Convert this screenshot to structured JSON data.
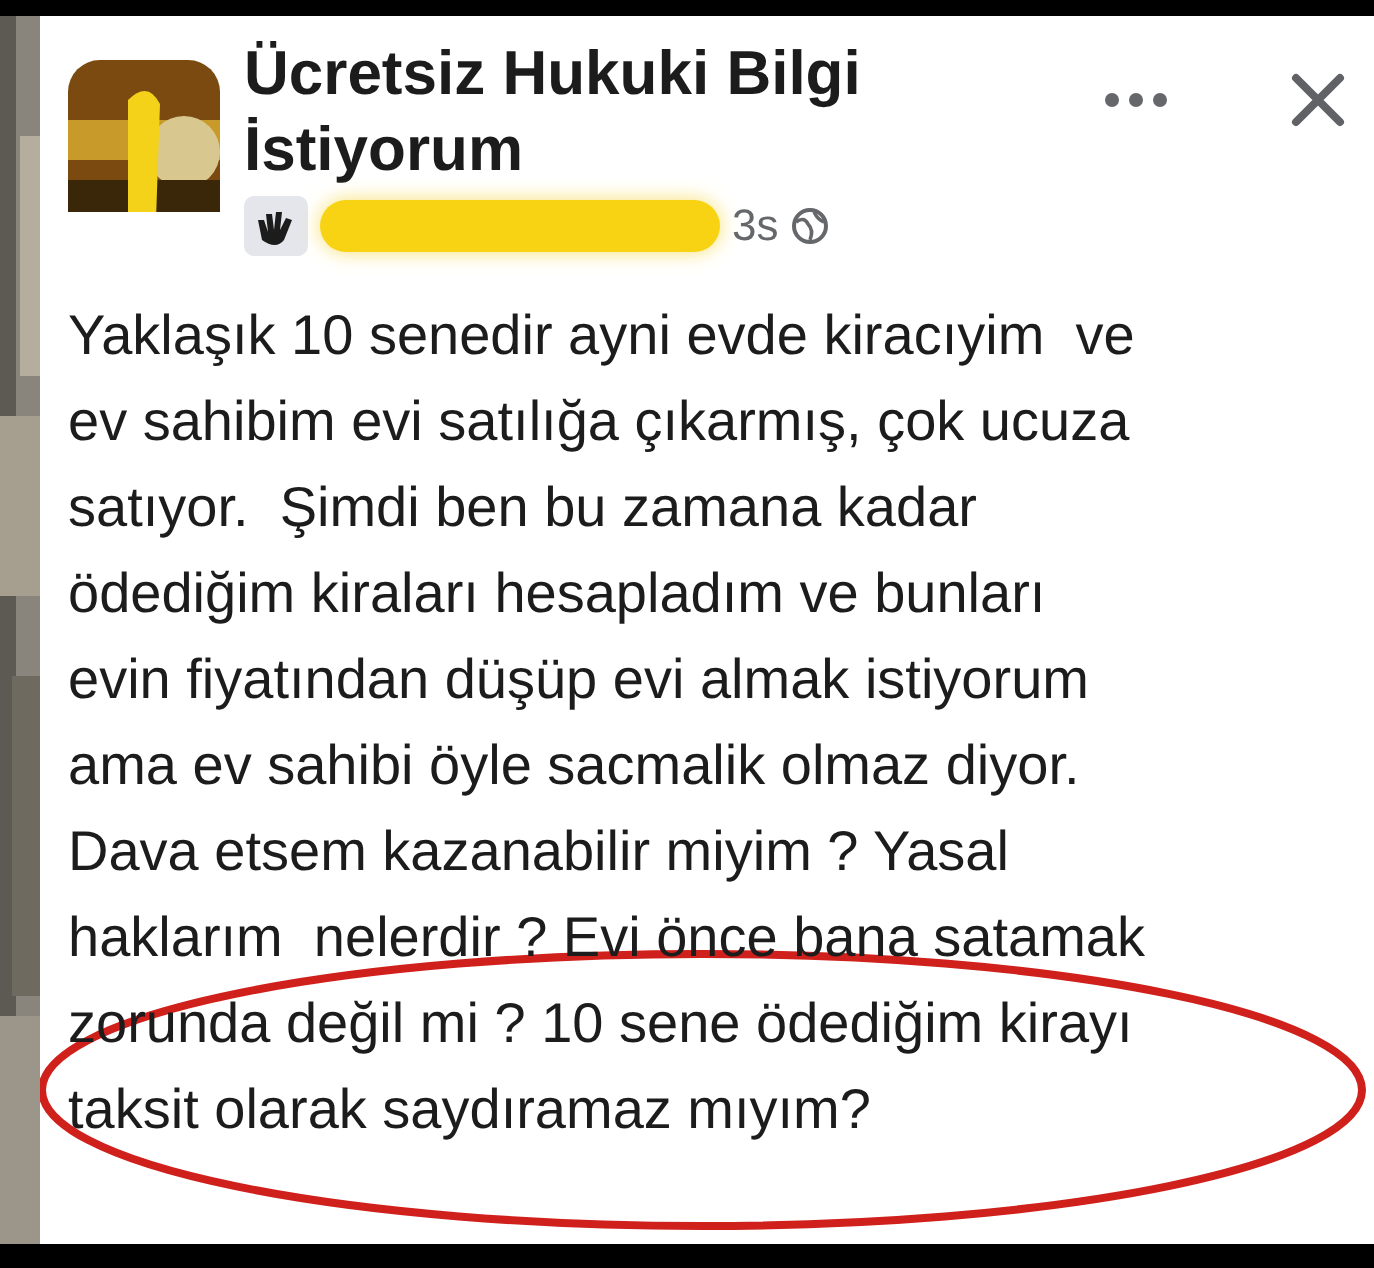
{
  "group_name": "Ücretsiz Hukuki Bilgi İstiyorum",
  "time": "3s",
  "post_lines": [
    "Yaklaşık 10 senedir ayni evde kiracıyim  ve",
    "ev sahibim evi satılığa çıkarmış, çok ucuza",
    "satıyor.  Şimdi ben bu zamana kadar",
    "ödediğim kiraları hesapladım ve bunları",
    "evin fiyatından düşüp evi almak istiyorum",
    "ama ev sahibi öyle sacmalik olmaz diyor.",
    "Dava etsem kazanabilir miyim ? Yasal",
    "haklarım  nelerdir ? Evi önce bana satamak",
    "zorunda değil mi ? 10 sene ödediğim kirayı",
    "taksit olarak saydıramaz mıyım?"
  ]
}
